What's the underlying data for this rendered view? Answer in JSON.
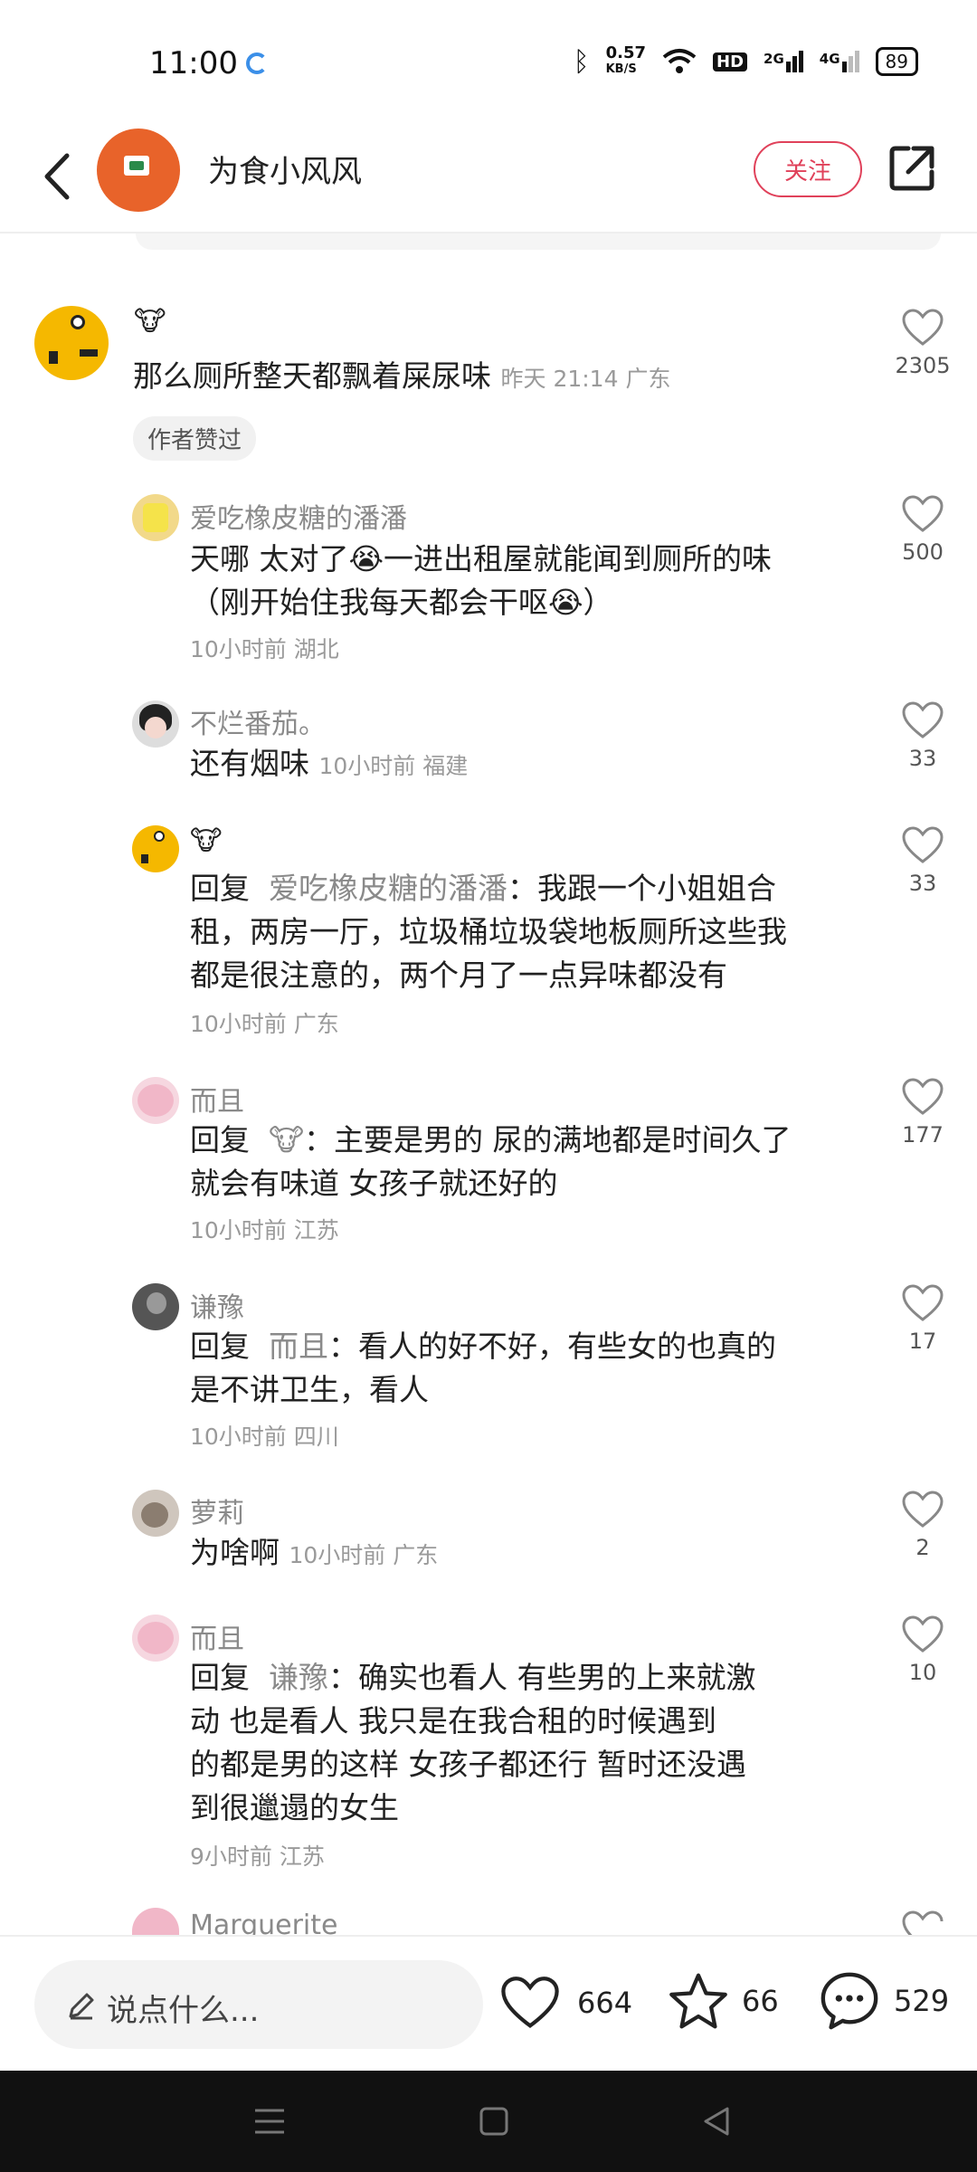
{
  "status": {
    "time": "11:00",
    "speed_top": "0.57",
    "speed_unit": "KB/S",
    "net1": "2G",
    "net2": "4G",
    "hd": "HD",
    "battery": "89"
  },
  "header": {
    "title": "为食小风风",
    "follow_label": "关注"
  },
  "comments": [
    {
      "name": "🐮",
      "text": "那么厕所整天都飘着屎尿味",
      "meta": "昨天 21:14 广东",
      "likes": "2305",
      "badge": "作者赞过"
    },
    {
      "name": "爱吃橡皮糖的潘潘",
      "text_line1": "天哪 太对了😭一进出租屋就能闻到厕所的味",
      "text_line2": "（刚开始住我每天都会干呕😭）",
      "meta": "10小时前  湖北",
      "likes": "500"
    },
    {
      "name": "不烂番茄。",
      "text": "还有烟味",
      "meta": "10小时前  福建",
      "likes": "33"
    },
    {
      "name": "🐮",
      "reply_prefix": "回复",
      "reply_target": "爱吃橡皮糖的潘潘",
      "text_line1": "：我跟一个小姐姐合",
      "text_line2": "租，两房一厅，垃圾桶垃圾袋地板厕所这些我",
      "text_line3": "都是很注意的，两个月了一点异味都没有",
      "meta": "10小时前  广东",
      "likes": "33"
    },
    {
      "name": "而且",
      "reply_prefix": "回复",
      "reply_target": "🐮",
      "text_line1": "：主要是男的 尿的满地都是时间久了",
      "text_line2": "就会有味道   女孩子就还好的",
      "meta": "10小时前  江苏",
      "likes": "177"
    },
    {
      "name": "谦豫",
      "reply_prefix": "回复",
      "reply_target": "而且",
      "text_line1": "：看人的好不好，有些女的也真的",
      "text_line2": "是不讲卫生，看人",
      "meta": "10小时前  四川",
      "likes": "17"
    },
    {
      "name": "萝莉",
      "text": "为啥啊",
      "meta": "10小时前  广东",
      "likes": "2"
    },
    {
      "name": "而且",
      "reply_prefix": "回复",
      "reply_target": "谦豫",
      "text_line1": "：确实也看人     有些男的上来就激",
      "text_line2": "动  也是看人         我只是在我合租的时候遇到",
      "text_line3": "的都是男的这样     女孩子都还行    暂时还没遇",
      "text_line4": "到很邋遢的女生",
      "meta": "9小时前  江苏",
      "likes": "10"
    },
    {
      "name": "Marguerite"
    }
  ],
  "bottom": {
    "input_placeholder": "说点什么...",
    "likes": "664",
    "stars": "66",
    "comments": "529"
  },
  "icons": {
    "back": "chevron-left-icon",
    "share": "share-icon",
    "heart": "heart-icon",
    "star": "star-icon",
    "comment": "comment-icon",
    "pencil": "pencil-icon"
  }
}
